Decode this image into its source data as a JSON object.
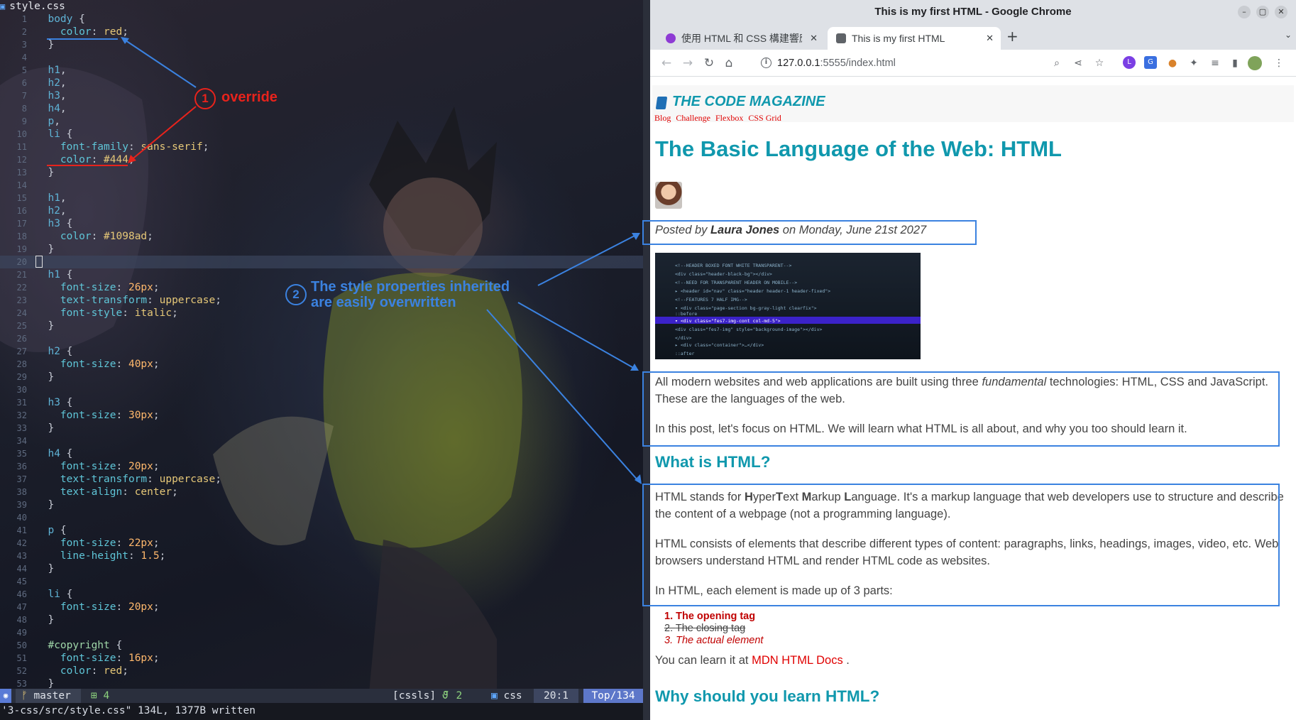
{
  "editor": {
    "filename": "style.css",
    "lines": [
      {
        "n": "1",
        "parts": [
          [
            "c-sel",
            "  body "
          ],
          [
            "c-punc",
            "{"
          ]
        ]
      },
      {
        "n": "2",
        "parts": [
          [
            "c-prop",
            "    color"
          ],
          [
            "c-punc",
            ": "
          ],
          [
            "c-val",
            "red"
          ],
          [
            "c-punc",
            ";"
          ]
        ]
      },
      {
        "n": "3",
        "parts": [
          [
            "c-punc",
            "  }"
          ]
        ]
      },
      {
        "n": "4",
        "parts": []
      },
      {
        "n": "5",
        "parts": [
          [
            "c-sel",
            "  h1"
          ],
          [
            "c-punc",
            ","
          ]
        ]
      },
      {
        "n": "6",
        "parts": [
          [
            "c-sel",
            "  h2"
          ],
          [
            "c-punc",
            ","
          ]
        ]
      },
      {
        "n": "7",
        "parts": [
          [
            "c-sel",
            "  h3"
          ],
          [
            "c-punc",
            ","
          ]
        ]
      },
      {
        "n": "8",
        "parts": [
          [
            "c-sel",
            "  h4"
          ],
          [
            "c-punc",
            ","
          ]
        ]
      },
      {
        "n": "9",
        "parts": [
          [
            "c-sel",
            "  p"
          ],
          [
            "c-punc",
            ","
          ]
        ]
      },
      {
        "n": "10",
        "parts": [
          [
            "c-sel",
            "  li "
          ],
          [
            "c-punc",
            "{"
          ]
        ]
      },
      {
        "n": "11",
        "parts": [
          [
            "c-prop",
            "    font-family"
          ],
          [
            "c-punc",
            ": "
          ],
          [
            "c-val",
            "sans-serif"
          ],
          [
            "c-punc",
            ";"
          ]
        ]
      },
      {
        "n": "12",
        "parts": [
          [
            "c-prop",
            "    color"
          ],
          [
            "c-punc",
            ": "
          ],
          [
            "c-val",
            "#444"
          ],
          [
            "c-punc",
            ";"
          ]
        ]
      },
      {
        "n": "13",
        "parts": [
          [
            "c-punc",
            "  }"
          ]
        ]
      },
      {
        "n": "14",
        "parts": []
      },
      {
        "n": "15",
        "parts": [
          [
            "c-sel",
            "  h1"
          ],
          [
            "c-punc",
            ","
          ]
        ]
      },
      {
        "n": "16",
        "parts": [
          [
            "c-sel",
            "  h2"
          ],
          [
            "c-punc",
            ","
          ]
        ]
      },
      {
        "n": "17",
        "parts": [
          [
            "c-sel",
            "  h3 "
          ],
          [
            "c-punc",
            "{"
          ]
        ]
      },
      {
        "n": "18",
        "parts": [
          [
            "c-prop",
            "    color"
          ],
          [
            "c-punc",
            ": "
          ],
          [
            "c-val",
            "#1098ad"
          ],
          [
            "c-punc",
            ";"
          ]
        ]
      },
      {
        "n": "19",
        "parts": [
          [
            "c-punc",
            "  }"
          ]
        ]
      },
      {
        "n": "20",
        "parts": [],
        "current": true
      },
      {
        "n": "21",
        "parts": [
          [
            "c-sel",
            "  h1 "
          ],
          [
            "c-punc",
            "{"
          ]
        ]
      },
      {
        "n": "22",
        "parts": [
          [
            "c-prop",
            "    font-size"
          ],
          [
            "c-punc",
            ": "
          ],
          [
            "c-num",
            "26px"
          ],
          [
            "c-punc",
            ";"
          ]
        ]
      },
      {
        "n": "23",
        "parts": [
          [
            "c-prop",
            "    text-transform"
          ],
          [
            "c-punc",
            ": "
          ],
          [
            "c-val",
            "uppercase"
          ],
          [
            "c-punc",
            ";"
          ]
        ]
      },
      {
        "n": "24",
        "parts": [
          [
            "c-prop",
            "    font-style"
          ],
          [
            "c-punc",
            ": "
          ],
          [
            "c-val",
            "italic"
          ],
          [
            "c-punc",
            ";"
          ]
        ]
      },
      {
        "n": "25",
        "parts": [
          [
            "c-punc",
            "  }"
          ]
        ]
      },
      {
        "n": "26",
        "parts": []
      },
      {
        "n": "27",
        "parts": [
          [
            "c-sel",
            "  h2 "
          ],
          [
            "c-punc",
            "{"
          ]
        ]
      },
      {
        "n": "28",
        "parts": [
          [
            "c-prop",
            "    font-size"
          ],
          [
            "c-punc",
            ": "
          ],
          [
            "c-num",
            "40px"
          ],
          [
            "c-punc",
            ";"
          ]
        ]
      },
      {
        "n": "29",
        "parts": [
          [
            "c-punc",
            "  }"
          ]
        ]
      },
      {
        "n": "30",
        "parts": []
      },
      {
        "n": "31",
        "parts": [
          [
            "c-sel",
            "  h3 "
          ],
          [
            "c-punc",
            "{"
          ]
        ]
      },
      {
        "n": "32",
        "parts": [
          [
            "c-prop",
            "    font-size"
          ],
          [
            "c-punc",
            ": "
          ],
          [
            "c-num",
            "30px"
          ],
          [
            "c-punc",
            ";"
          ]
        ]
      },
      {
        "n": "33",
        "parts": [
          [
            "c-punc",
            "  }"
          ]
        ]
      },
      {
        "n": "34",
        "parts": []
      },
      {
        "n": "35",
        "parts": [
          [
            "c-sel",
            "  h4 "
          ],
          [
            "c-punc",
            "{"
          ]
        ]
      },
      {
        "n": "36",
        "parts": [
          [
            "c-prop",
            "    font-size"
          ],
          [
            "c-punc",
            ": "
          ],
          [
            "c-num",
            "20px"
          ],
          [
            "c-punc",
            ";"
          ]
        ]
      },
      {
        "n": "37",
        "parts": [
          [
            "c-prop",
            "    text-transform"
          ],
          [
            "c-punc",
            ": "
          ],
          [
            "c-val",
            "uppercase"
          ],
          [
            "c-punc",
            ";"
          ]
        ]
      },
      {
        "n": "38",
        "parts": [
          [
            "c-prop",
            "    text-align"
          ],
          [
            "c-punc",
            ": "
          ],
          [
            "c-val",
            "center"
          ],
          [
            "c-punc",
            ";"
          ]
        ]
      },
      {
        "n": "39",
        "parts": [
          [
            "c-punc",
            "  }"
          ]
        ]
      },
      {
        "n": "40",
        "parts": []
      },
      {
        "n": "41",
        "parts": [
          [
            "c-sel",
            "  p "
          ],
          [
            "c-punc",
            "{"
          ]
        ]
      },
      {
        "n": "42",
        "parts": [
          [
            "c-prop",
            "    font-size"
          ],
          [
            "c-punc",
            ": "
          ],
          [
            "c-num",
            "22px"
          ],
          [
            "c-punc",
            ";"
          ]
        ]
      },
      {
        "n": "43",
        "parts": [
          [
            "c-prop",
            "    line-height"
          ],
          [
            "c-punc",
            ": "
          ],
          [
            "c-num",
            "1.5"
          ],
          [
            "c-punc",
            ";"
          ]
        ]
      },
      {
        "n": "44",
        "parts": [
          [
            "c-punc",
            "  }"
          ]
        ]
      },
      {
        "n": "45",
        "parts": []
      },
      {
        "n": "46",
        "parts": [
          [
            "c-sel",
            "  li "
          ],
          [
            "c-punc",
            "{"
          ]
        ]
      },
      {
        "n": "47",
        "parts": [
          [
            "c-prop",
            "    font-size"
          ],
          [
            "c-punc",
            ": "
          ],
          [
            "c-num",
            "20px"
          ],
          [
            "c-punc",
            ";"
          ]
        ]
      },
      {
        "n": "48",
        "parts": [
          [
            "c-punc",
            "  }"
          ]
        ]
      },
      {
        "n": "49",
        "parts": []
      },
      {
        "n": "50",
        "parts": [
          [
            "c-id",
            "  #copyright "
          ],
          [
            "c-punc",
            "{"
          ]
        ]
      },
      {
        "n": "51",
        "parts": [
          [
            "c-prop",
            "    font-size"
          ],
          [
            "c-punc",
            ": "
          ],
          [
            "c-num",
            "16px"
          ],
          [
            "c-punc",
            ";"
          ]
        ]
      },
      {
        "n": "52",
        "parts": [
          [
            "c-prop",
            "    color"
          ],
          [
            "c-punc",
            ": "
          ],
          [
            "c-val",
            "red"
          ],
          [
            "c-punc",
            ";"
          ]
        ]
      },
      {
        "n": "53",
        "parts": [
          [
            "c-punc",
            "  }"
          ]
        ]
      }
    ],
    "status": {
      "branch": "master",
      "diff": "⊞ 4",
      "lsp": "[cssls]",
      "git2": "⁷ 2",
      "filetype": "css",
      "position": "20:1",
      "percent": "Top/134"
    },
    "cmdline": "'3-css/src/style.css\" 134L, 1377B written"
  },
  "annotations": {
    "one_num": "1",
    "one_label": "override",
    "two_num": "2",
    "two_line1": "The style properties inherited",
    "two_line2": "are easily overwritten",
    "color_red": "#e8231c",
    "color_blue": "#3b82e0"
  },
  "browser": {
    "window_title": "This is my first HTML - Google Chrome",
    "tabs": [
      {
        "label": "使用 HTML 和 CSS 構建響應",
        "active": false
      },
      {
        "label": "This is my first HTML",
        "active": true
      }
    ],
    "url_host": "127.0.0.1",
    "url_path": ":5555/index.html",
    "page": {
      "logo": "THE CODE MAGAZINE",
      "nav": [
        "Blog",
        "Challenge",
        "Flexbox",
        "CSS Grid"
      ],
      "title": "The Basic Language of the Web: HTML",
      "posted_prefix": "Posted by ",
      "author": "Laura Jones",
      "posted_suffix": " on Monday, June 21st 2027",
      "p1_a": "All modern websites and web applications are built using three ",
      "p1_em": "fundamental",
      "p1_b": " technologies: HTML, CSS and JavaScript.",
      "p1_c": "These are the languages of the web.",
      "p2": "In this post, let's focus on HTML. We will learn what HTML is all about, and why you too should learn it.",
      "h2_what": "What is HTML?",
      "p3_a": "HTML stands for ",
      "p3_H": "H",
      "p3_yper": "yper",
      "p3_T": "T",
      "p3_ext": "ext ",
      "p3_M": "M",
      "p3_arkup": "arkup ",
      "p3_L": "L",
      "p3_rest": "anguage. It's a markup language that web developers use to structure and describe",
      "p3_line2": "the content of a webpage (not a programming language).",
      "p4_line1": "HTML consists of elements that describe different types of content: paragraphs, links, headings, images, video, etc. Web",
      "p4_line2": "browsers understand HTML and render HTML code as websites.",
      "p5": "In HTML, each element is made up of 3 parts:",
      "list": [
        "The opening tag",
        "The closing tag",
        "The actual element"
      ],
      "learn_prefix": "You can learn it at ",
      "learn_link": "MDN HTML Docs",
      "learn_suffix": " .",
      "h2_why": "Why should you learn HTML?"
    }
  }
}
